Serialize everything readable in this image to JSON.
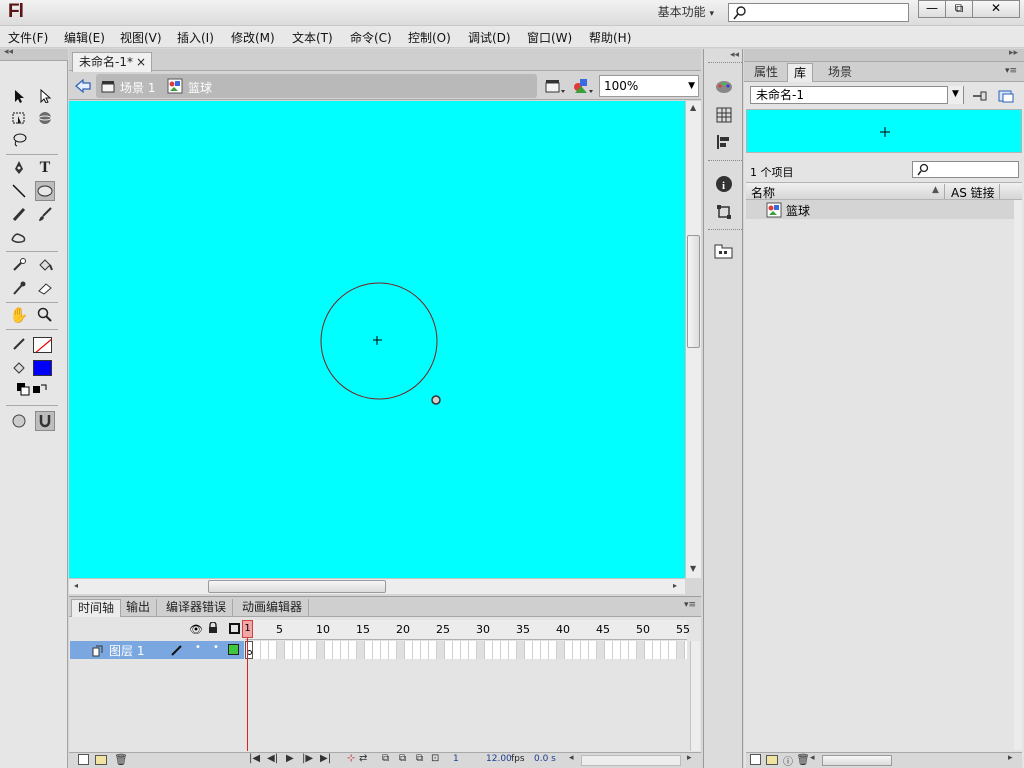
{
  "app": {
    "logo": "Fl",
    "workspace_label": "基本功能",
    "workspace_arrow": "▾",
    "window_buttons": {
      "minimize": "—",
      "restore": "⧉",
      "close": "✕"
    }
  },
  "menu": [
    "文件(F)",
    "编辑(E)",
    "视图(V)",
    "插入(I)",
    "修改(M)",
    "文本(T)",
    "命令(C)",
    "控制(O)",
    "调试(D)",
    "窗口(W)",
    "帮助(H)"
  ],
  "document": {
    "tab_title": "未命名-1*",
    "tab_close": "×",
    "scene_label": "场景 1",
    "symbol_label": "篮球",
    "zoom": "100%"
  },
  "timeline": {
    "tabs": [
      "时间轴",
      "输出",
      "编译器错误",
      "动画编辑器"
    ],
    "active_tab": 0,
    "ruler_labels": [
      "5",
      "10",
      "15",
      "20",
      "25",
      "30",
      "35",
      "40",
      "45",
      "50",
      "55"
    ],
    "playhead_label": "1",
    "layer_name": "图层 1",
    "status": {
      "frame": "1",
      "fps": "12.00",
      "fps_unit": "fps",
      "time": "0.0 s"
    }
  },
  "right_panel": {
    "tabs": [
      "属性",
      "库",
      "场景"
    ],
    "active_tab": 1,
    "library_doc": "未命名-1",
    "item_count": "1 个项目",
    "col_name": "名称",
    "col_linkage": "AS 链接",
    "items": [
      {
        "name": "篮球"
      }
    ]
  },
  "colors": {
    "stage": "#00ffff",
    "fill_swatch": "#0000ff",
    "layer_highlight": "#7aa7e0",
    "playhead": "#e02020"
  }
}
